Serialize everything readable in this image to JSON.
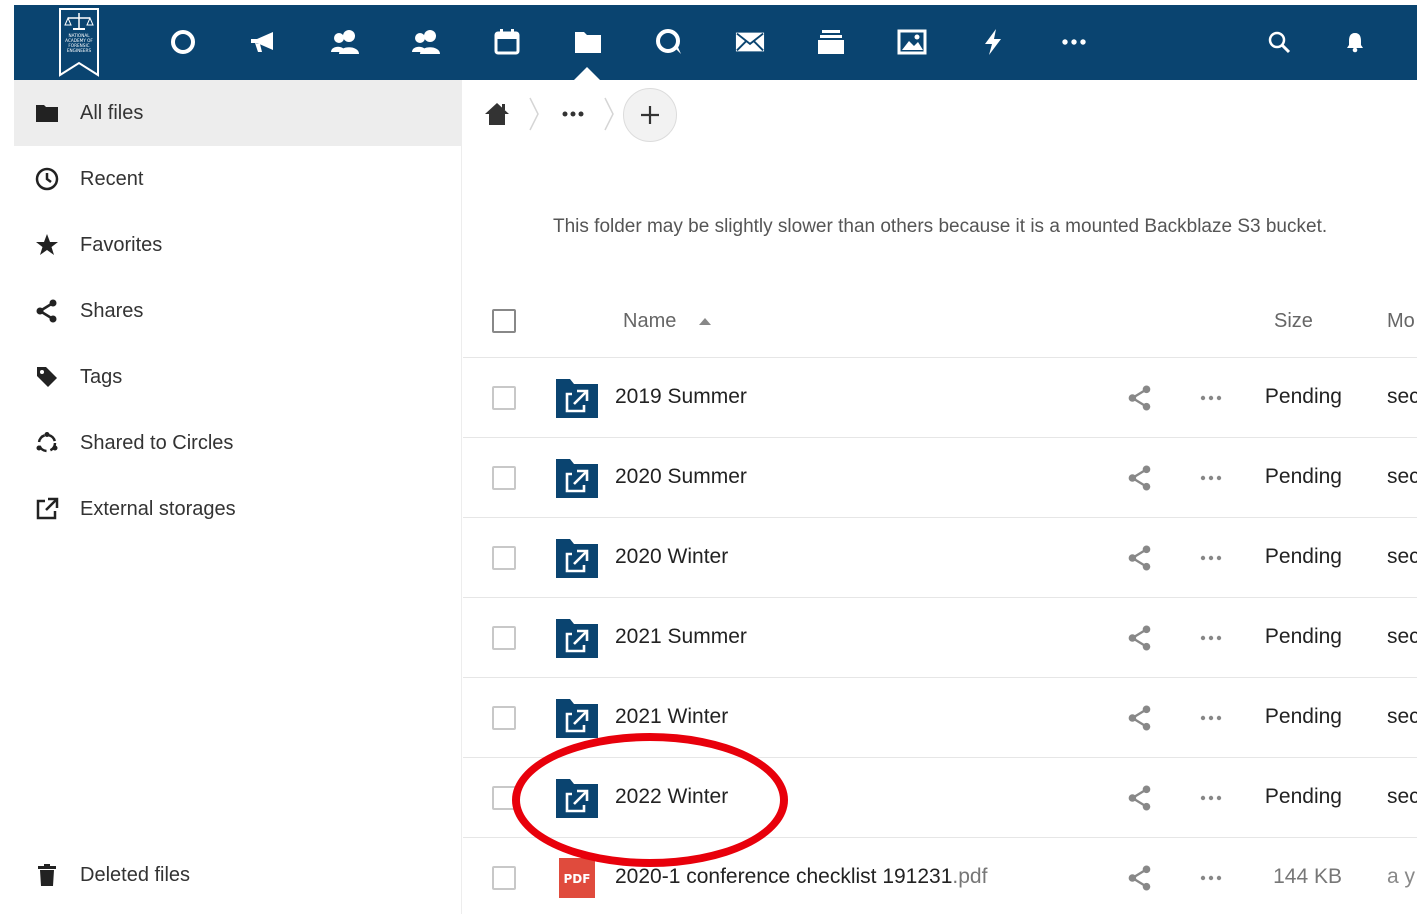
{
  "header": {
    "logo_lines": [
      "NATIONAL",
      "ACADEMY OF",
      "FORENSIC",
      "ENGINEERS"
    ],
    "nav": [
      {
        "icon": "dashboard-circle-icon",
        "name": "nav-dashboard"
      },
      {
        "icon": "megaphone-icon",
        "name": "nav-announcements"
      },
      {
        "icon": "contacts-icon",
        "name": "nav-contacts"
      },
      {
        "icon": "circles-icon",
        "name": "nav-circles"
      },
      {
        "icon": "calendar-icon",
        "name": "nav-calendar"
      },
      {
        "icon": "folder-icon",
        "name": "nav-files"
      },
      {
        "icon": "talk-icon",
        "name": "nav-talk"
      },
      {
        "icon": "mail-icon",
        "name": "nav-mail"
      },
      {
        "icon": "deck-icon",
        "name": "nav-deck"
      },
      {
        "icon": "photos-icon",
        "name": "nav-photos"
      },
      {
        "icon": "activity-bolt-icon",
        "name": "nav-activity"
      },
      {
        "icon": "more-apps-icon",
        "name": "nav-more-apps"
      }
    ],
    "active_index": 5
  },
  "sidebar": {
    "items": [
      {
        "label": "All files",
        "icon": "folder-icon",
        "active": true
      },
      {
        "label": "Recent",
        "icon": "clock-icon"
      },
      {
        "label": "Favorites",
        "icon": "star-icon"
      },
      {
        "label": "Shares",
        "icon": "share-icon"
      },
      {
        "label": "Tags",
        "icon": "tag-icon"
      },
      {
        "label": "Shared to Circles",
        "icon": "circles-icon"
      },
      {
        "label": "External storages",
        "icon": "external-link-icon"
      }
    ],
    "deleted": {
      "label": "Deleted files",
      "icon": "trash-icon"
    }
  },
  "breadcrumb": {
    "more": "•••"
  },
  "folder_note": "This folder may be slightly slower than others because it is a mounted Backblaze S3 bucket.",
  "table": {
    "headers": {
      "name": "Name",
      "size": "Size",
      "modified": "Mo"
    },
    "rows": [
      {
        "name": "2019 Summer",
        "ext": "",
        "type": "folder-external",
        "size": "Pending",
        "modified": "sec"
      },
      {
        "name": "2020 Summer",
        "ext": "",
        "type": "folder-external",
        "size": "Pending",
        "modified": "sec"
      },
      {
        "name": "2020 Winter",
        "ext": "",
        "type": "folder-external",
        "size": "Pending",
        "modified": "sec"
      },
      {
        "name": "2021 Summer",
        "ext": "",
        "type": "folder-external",
        "size": "Pending",
        "modified": "sec"
      },
      {
        "name": "2021 Winter",
        "ext": "",
        "type": "folder-external",
        "size": "Pending",
        "modified": "sec"
      },
      {
        "name": "2022 Winter",
        "ext": "",
        "type": "folder-external",
        "size": "Pending",
        "modified": "sec"
      },
      {
        "name": "2020-1 conference checklist 191231",
        "ext": ".pdf",
        "type": "pdf",
        "pdf_label": "PDF",
        "size": "144 KB",
        "modified": "a y"
      }
    ]
  },
  "colors": {
    "header": "#0a4470",
    "folder": "#0a4470",
    "pdf": "#e04b3d",
    "highlight": "#e8000b"
  }
}
